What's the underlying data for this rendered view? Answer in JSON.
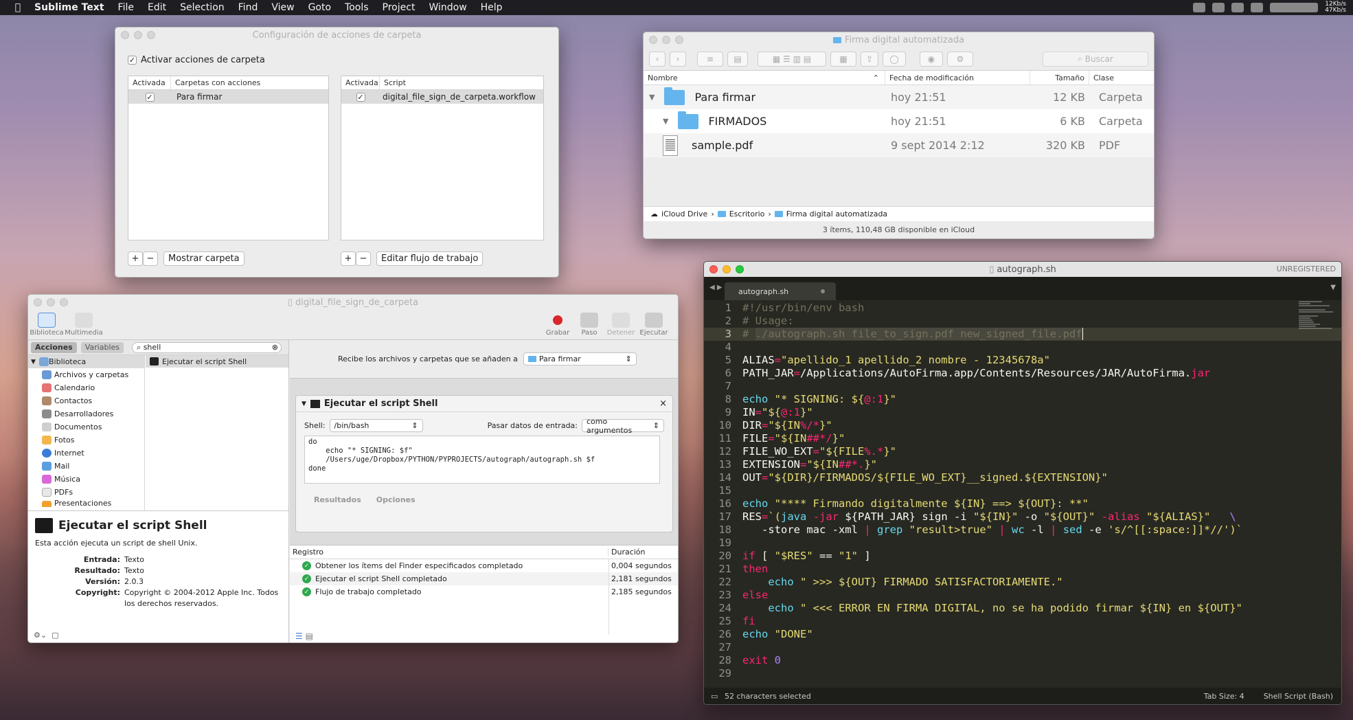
{
  "menubar": {
    "app": "Sublime Text",
    "items": [
      "File",
      "Edit",
      "Selection",
      "Find",
      "View",
      "Goto",
      "Tools",
      "Project",
      "Window",
      "Help"
    ],
    "net_up": "12Kb/s",
    "net_down": "47Kb/s"
  },
  "folder_actions": {
    "title": "Configuración de acciones de carpeta",
    "enable_label": "Activar acciones de carpeta",
    "left_headers": [
      "Activada",
      "Carpetas con acciones"
    ],
    "left_rows": [
      {
        "checked": "✓",
        "name": "Para firmar"
      }
    ],
    "right_headers": [
      "Activada",
      "Script"
    ],
    "right_rows": [
      {
        "checked": "✓",
        "name": "digital_file_sign_de_carpeta.workflow"
      }
    ],
    "show_folder": "Mostrar carpeta",
    "edit_workflow": "Editar flujo de trabajo",
    "plus": "+",
    "minus": "−"
  },
  "finder": {
    "title": "Firma digital automatizada",
    "search_placeholder": "Buscar",
    "columns": [
      "Nombre",
      "Fecha de modificación",
      "Tamaño",
      "Clase"
    ],
    "rows": [
      {
        "name": "Para firmar",
        "date": "hoy 21:51",
        "size": "12 KB",
        "kind": "Carpeta"
      },
      {
        "name": "FIRMADOS",
        "date": "hoy 21:51",
        "size": "6 KB",
        "kind": "Carpeta"
      },
      {
        "name": "sample.pdf",
        "date": "9 sept 2014 2:12",
        "size": "320 KB",
        "kind": "PDF"
      }
    ],
    "path": [
      "iCloud Drive",
      "Escritorio",
      "Firma digital automatizada"
    ],
    "status": "3 ítems, 110,48 GB disponible en iCloud"
  },
  "automator": {
    "title": "digital_file_sign_de_carpeta",
    "toolbar": {
      "library": "Biblioteca",
      "media": "Multimedia",
      "record": "Grabar",
      "step": "Paso",
      "stop": "Detener",
      "run": "Ejecutar"
    },
    "tabs": {
      "actions": "Acciones",
      "variables": "Variables"
    },
    "search_value": "shell",
    "library_items": [
      "Biblioteca",
      "Archivos y carpetas",
      "Calendario",
      "Contactos",
      "Desarrolladores",
      "Documentos",
      "Fotos",
      "Internet",
      "Mail",
      "Música",
      "PDFs",
      "Presentaciones"
    ],
    "result_item": "Ejecutar el script Shell",
    "receive_label": "Recibe los archivos y carpetas que se añaden a",
    "receive_value": "Para firmar",
    "action": {
      "title": "Ejecutar el script Shell",
      "shell_label": "Shell:",
      "shell_value": "/bin/bash",
      "pass_label": "Pasar datos de entrada:",
      "pass_value": "como argumentos",
      "code": "do\n    echo \"* SIGNING: $f\"\n    /Users/uge/Dropbox/PYTHON/PYPROJECTS/autograph/autograph.sh $f\ndone",
      "results": "Resultados",
      "options": "Opciones"
    },
    "desc": {
      "title": "Ejecutar el script Shell",
      "text": "Esta acción ejecuta un script de shell Unix.",
      "fields": [
        {
          "k": "Entrada:",
          "v": "Texto"
        },
        {
          "k": "Resultado:",
          "v": "Texto"
        },
        {
          "k": "Versión:",
          "v": "2.0.3"
        },
        {
          "k": "Copyright:",
          "v": "Copyright © 2004-2012 Apple Inc. Todos los derechos reservados."
        }
      ]
    },
    "log": {
      "headers": [
        "Registro",
        "Duración"
      ],
      "rows": [
        {
          "text": "Obtener los ítems del Finder especificados completado",
          "dur": "0,004 segundos"
        },
        {
          "text": "Ejecutar el script Shell completado",
          "dur": "2,181 segundos"
        },
        {
          "text": "Flujo de trabajo completado",
          "dur": "2,185 segundos"
        }
      ]
    }
  },
  "sublime": {
    "title": "autograph.sh",
    "unregistered": "UNREGISTERED",
    "tab": "autograph.sh",
    "status_left": "52 characters selected",
    "tab_size": "Tab Size: 4",
    "syntax": "Shell Script (Bash)"
  },
  "colors": {
    "accent_blue": "#64b4ee",
    "monokai_bg": "#272822",
    "ok_green": "#2fa84f"
  }
}
